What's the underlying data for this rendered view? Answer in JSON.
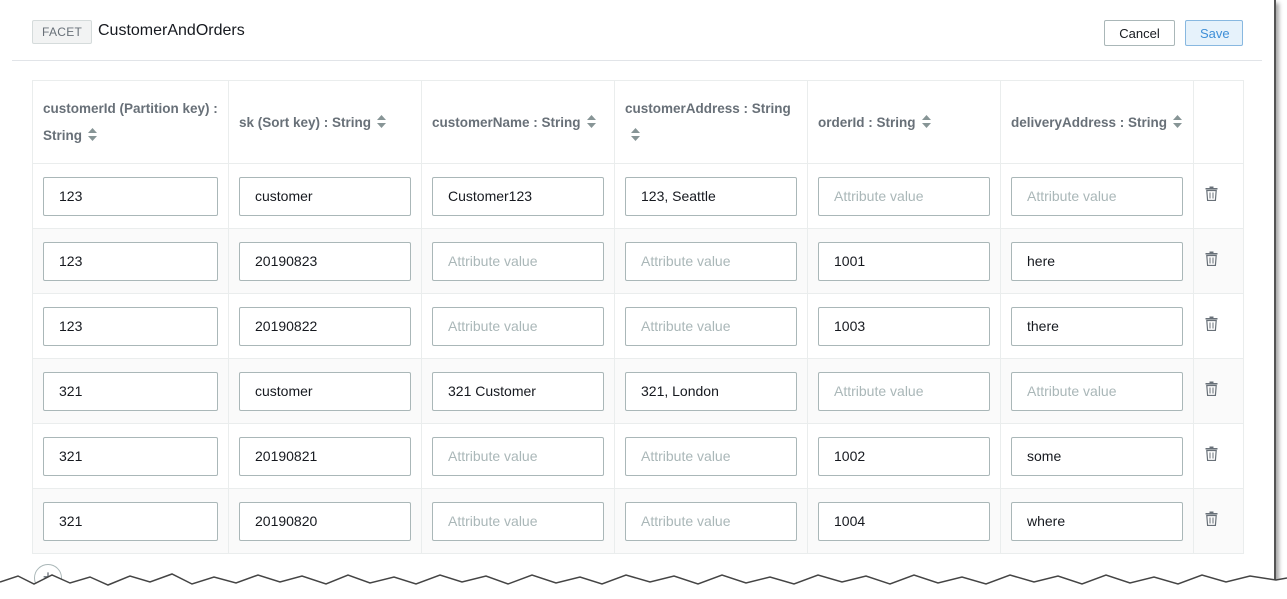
{
  "header": {
    "badge": "FACET",
    "title": "CustomerAndOrders",
    "cancel_label": "Cancel",
    "save_label": "Save"
  },
  "table": {
    "columns": [
      "customerId (Partition key) : String",
      "sk (Sort key) : String",
      "customerName : String",
      "customerAddress : String",
      "orderId : String",
      "deliveryAddress : String"
    ],
    "placeholder": "Attribute value",
    "rows": [
      [
        "123",
        "customer",
        "Customer123",
        "123, Seattle",
        "",
        ""
      ],
      [
        "123",
        "20190823",
        "",
        "",
        "1001",
        "here"
      ],
      [
        "123",
        "20190822",
        "",
        "",
        "1003",
        "there"
      ],
      [
        "321",
        "customer",
        "321 Customer",
        "321, London",
        "",
        ""
      ],
      [
        "321",
        "20190821",
        "",
        "",
        "1002",
        "some"
      ],
      [
        "321",
        "20190820",
        "",
        "",
        "1004",
        "where"
      ]
    ]
  },
  "add_button_label": "+",
  "icons": {
    "sort": "sort-icon",
    "delete": "trash-icon",
    "add": "add-icon"
  }
}
